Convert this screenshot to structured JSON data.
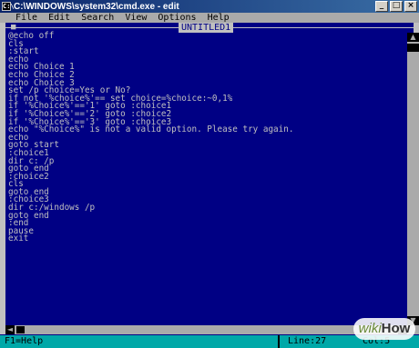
{
  "window": {
    "title": "C:\\WINDOWS\\system32\\cmd.exe - edit",
    "icon_label": "C:\\",
    "buttons": {
      "minimize": "_",
      "maximize": "□",
      "close": "×"
    }
  },
  "menubar": {
    "items": [
      {
        "label": "File"
      },
      {
        "label": "Edit"
      },
      {
        "label": "Search"
      },
      {
        "label": "View"
      },
      {
        "label": "Options"
      },
      {
        "label": "Help"
      }
    ]
  },
  "document": {
    "title": "UNTITLED1",
    "close_glyph": "■"
  },
  "editor": {
    "lines": [
      "@echo off",
      "cls",
      ":start",
      "echo",
      "echo Choice 1",
      "echo Choice 2",
      "echo Choice 3",
      "set /p choice=Yes or No?",
      "if not '%choice%'== set choice=%choice:~0,1%",
      "if '%Choice%'=='1' goto :choice1",
      "if '%Choice%'=='2' goto :choice2",
      "if '%Choice%'=='3' goto :choice3",
      "echo \"%Choice%\" is not a valid option. Please try again.",
      "echo",
      "goto start",
      ":choice1",
      "dir c: /p",
      "goto end",
      ":choice2",
      "cls",
      "goto end",
      ":choice3",
      "dir c:/windows /p",
      "goto end",
      ":end",
      "pause",
      "exit"
    ]
  },
  "scrollbars": {
    "up_arrow": "▲",
    "down_arrow": "▼",
    "left_arrow": "◄",
    "right_arrow": "►"
  },
  "statusbar": {
    "help": "F1=Help",
    "line": "Line:27",
    "col": "Col:5"
  },
  "watermark": {
    "wiki": "wiki",
    "how": "How"
  },
  "colors": {
    "editor_background": "#000084",
    "editor_text": "#c0c0c0",
    "menubar_background": "#aaaaaa",
    "statusbar_background": "#00a8a8"
  }
}
